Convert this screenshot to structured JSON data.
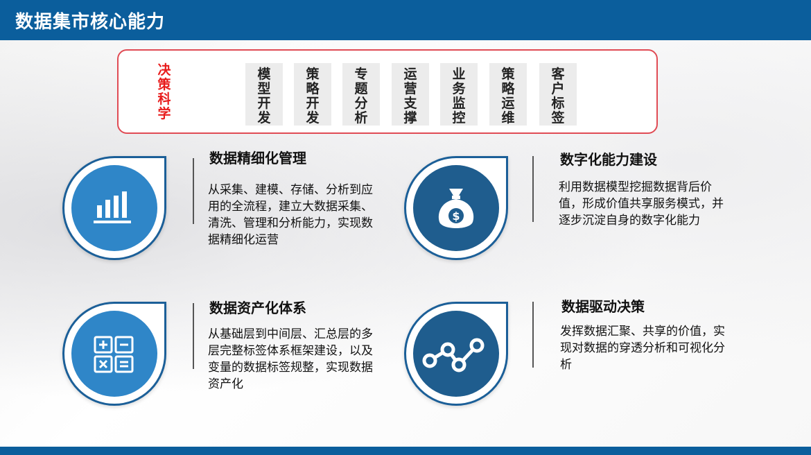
{
  "header": {
    "title": "数据集市核心能力"
  },
  "capabilities": {
    "label": "决策科学",
    "items": [
      "模型开发",
      "策略开发",
      "专题分析",
      "运营支撑",
      "业务监控",
      "策略运维",
      "客户标签"
    ]
  },
  "features": [
    {
      "title": "数据精细化管理",
      "desc": "从采集、建模、存储、分析到应用的全流程，建立大数据采集、清洗、管理和分析能力，实现数据精细化运营",
      "icon": "bar-chart-icon"
    },
    {
      "title": "数字化能力建设",
      "desc": "利用数据模型挖掘数据背后价值，形成价值共享服务模式，并逐步沉淀自身的数字化能力",
      "icon": "money-bag-icon"
    },
    {
      "title": "数据资产化体系",
      "desc": "从基础层到中间层、汇总层的多层完整标签体系框架建设，以及变量的数据标签规整，实现数据资产化",
      "icon": "calculator-icon"
    },
    {
      "title": "数据驱动决策",
      "desc": "发挥数据汇聚、共享的价值，实现对数据的穿透分析和可视化分析",
      "icon": "line-graph-icon"
    }
  ],
  "colors": {
    "header": "#0b5e9c",
    "accent_red": "#e04b54",
    "badge_light": "#2f86c8",
    "badge_dark": "#1f5d8e"
  }
}
